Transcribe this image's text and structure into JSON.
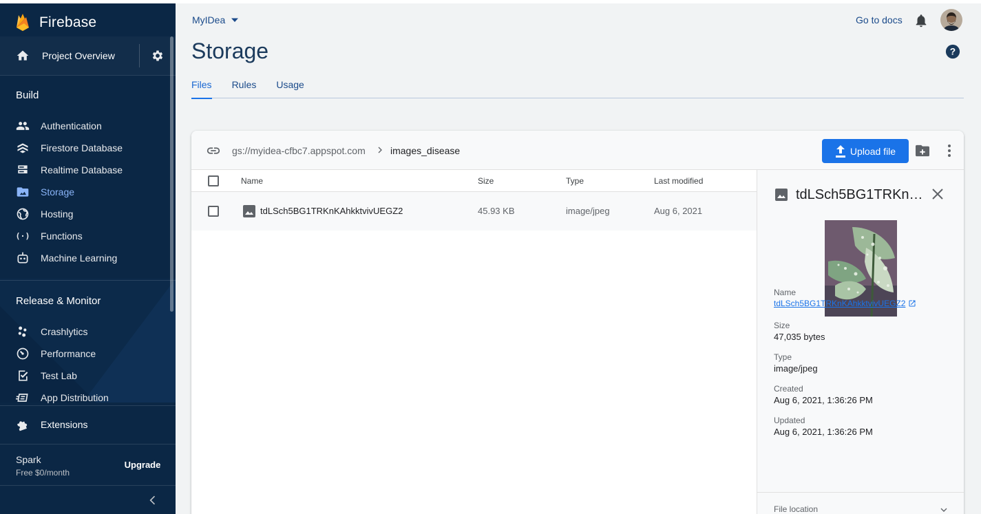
{
  "app": {
    "brand": "Firebase"
  },
  "sidebar": {
    "project_overview": "Project Overview",
    "sections": [
      {
        "title": "Build",
        "items": [
          "Authentication",
          "Firestore Database",
          "Realtime Database",
          "Storage",
          "Hosting",
          "Functions",
          "Machine Learning"
        ]
      },
      {
        "title": "Release & Monitor",
        "items": [
          "Crashlytics",
          "Performance",
          "Test Lab",
          "App Distribution"
        ]
      }
    ],
    "active_item": "Storage",
    "extensions": "Extensions",
    "plan": {
      "name": "Spark",
      "price": "Free $0/month",
      "upgrade": "Upgrade"
    }
  },
  "header": {
    "project": "MyIDea",
    "go_to_docs": "Go to docs",
    "page_title": "Storage",
    "tabs": [
      "Files",
      "Rules",
      "Usage"
    ],
    "active_tab": "Files"
  },
  "browser": {
    "bucket": "gs://myidea-cfbc7.appspot.com",
    "folder": "images_disease",
    "upload_label": "Upload file",
    "columns": [
      "Name",
      "Size",
      "Type",
      "Last modified"
    ],
    "rows": [
      {
        "name": "tdLSch5BG1TRKnKAhkktvivUEGZ2",
        "size": "45.93 KB",
        "type": "image/jpeg",
        "modified": "Aug 6, 2021"
      }
    ]
  },
  "details": {
    "title": "tdLSch5BG1TRKnKAhkktvivUEGZ2",
    "fields": [
      {
        "label": "Name",
        "value": "tdLSch5BG1TRKnKAhkktvivUEGZ2"
      },
      {
        "label": "Size",
        "value": "47,035 bytes"
      },
      {
        "label": "Type",
        "value": "image/jpeg"
      },
      {
        "label": "Created",
        "value": "Aug 6, 2021, 1:36:26 PM"
      },
      {
        "label": "Updated",
        "value": "Aug 6, 2021, 1:36:26 PM"
      }
    ],
    "file_location": "File location"
  },
  "colors": {
    "sidebar": "#0b2745",
    "accent": "#1a73e8",
    "active_nav": "#8ab4f8",
    "page_bg": "#f1f3f4"
  }
}
